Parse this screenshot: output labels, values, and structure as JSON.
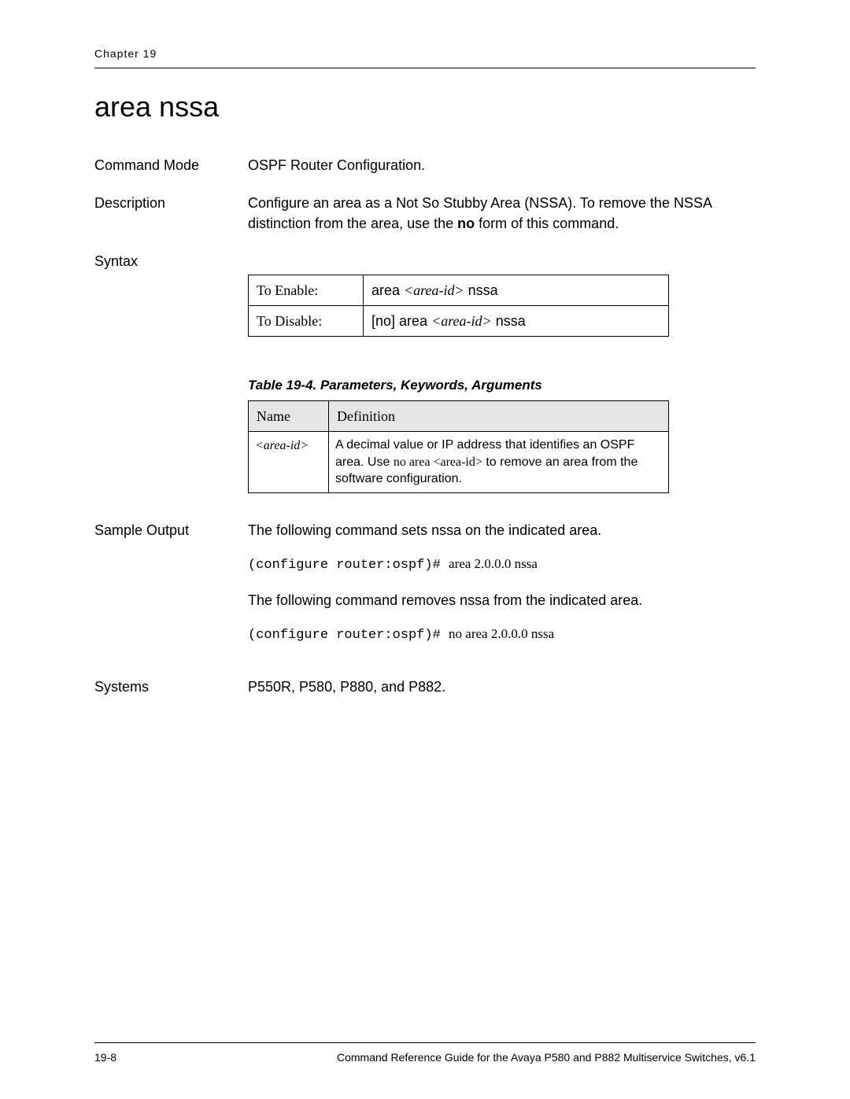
{
  "header": {
    "chapter": "Chapter 19"
  },
  "command": {
    "title": "area nssa",
    "sections": {
      "command_mode_label": "Command Mode",
      "command_mode_value": "OSPF Router Configuration.",
      "description_label": "Description",
      "description_text_a": "Configure an area as a Not So Stubby Area (NSSA). To remove the NSSA distinction from the area, use the ",
      "description_bold": "no",
      "description_text_b": " form of this command.",
      "syntax_label": "Syntax",
      "syntax_table": {
        "rows": [
          {
            "label": "To Enable:",
            "pre": "area ",
            "var": "<area-id>",
            "post": " nssa"
          },
          {
            "label": "To Disable:",
            "pre": "[no] area ",
            "var": "<area-id>",
            "post": " nssa"
          }
        ]
      },
      "param_caption": "Table 19-4.  Parameters, Keywords, Arguments",
      "param_table": {
        "headers": {
          "name": "Name",
          "definition": "Definition"
        },
        "row": {
          "var": "<area-id>",
          "def_a": "A decimal value or IP address that identifies an OSPF area. Use ",
          "def_code": "no area <area-id>",
          "def_b": " to remove an area from the software configuration."
        }
      },
      "sample_label": "Sample Output",
      "sample_text1": "The following command sets nssa on the indicated area.",
      "sample_code1_prompt": "(configure router:ospf)# ",
      "sample_code1_cmd": "area 2.0.0.0 nssa",
      "sample_text2": "The following command removes nssa from the indicated area.",
      "sample_code2_prompt": "(configure router:ospf)# ",
      "sample_code2_cmd": "no area 2.0.0.0 nssa",
      "systems_label": "Systems",
      "systems_value": "P550R, P580, P880, and P882."
    }
  },
  "footer": {
    "page_no": "19-8",
    "doc_title": "Command Reference Guide for the Avaya P580 and P882 Multiservice Switches, v6.1"
  }
}
